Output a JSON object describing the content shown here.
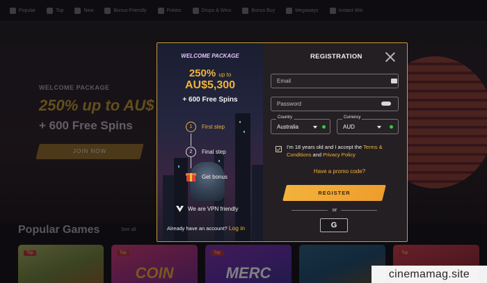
{
  "nav": {
    "items": [
      {
        "icon": "popular-icon",
        "label": "Popular"
      },
      {
        "icon": "top-icon",
        "label": "Top"
      },
      {
        "icon": "new-icon",
        "label": "New"
      },
      {
        "icon": "bonus-friendly-icon",
        "label": "Bonus-Friendly"
      },
      {
        "icon": "pokies-icon",
        "label": "Pokies"
      },
      {
        "icon": "drops-wins-icon",
        "label": "Drops & Wins"
      },
      {
        "icon": "bonus-buy-icon",
        "label": "Bonus Buy"
      },
      {
        "icon": "megaways-icon",
        "label": "Megaways"
      },
      {
        "icon": "instant-win-icon",
        "label": "Instant Win"
      }
    ]
  },
  "hero": {
    "subtitle": "WELCOME PACKAGE",
    "headline": "250% up to AU$",
    "spins": "+ 600 Free Spins",
    "cta": "JOIN NOW"
  },
  "games": {
    "title": "Popular Games",
    "see_all": "See all",
    "badge": "Top",
    "cards": [
      {
        "title": ""
      },
      {
        "title": "COIN"
      },
      {
        "title": "MERC"
      },
      {
        "title": ""
      },
      {
        "title": ""
      }
    ]
  },
  "modal": {
    "left": {
      "package_label": "WELCOME PACKAGE",
      "percent": "250%",
      "up_to": "up to",
      "amount": "AU$5,300",
      "free_spins": "+ 600 Free Spins",
      "steps": [
        {
          "num": "1",
          "label": "First step"
        },
        {
          "num": "2",
          "label": "Final step"
        },
        {
          "num": "",
          "label": "Get bonus"
        }
      ],
      "vpn": "We are VPN friendly",
      "have_account": "Already have an account?",
      "login": "Log in"
    },
    "title": "REGISTRATION",
    "email_placeholder": "Email",
    "password_placeholder": "Password",
    "country_label": "Country",
    "country_value": "Australia",
    "currency_label": "Currency",
    "currency_value": "AUD",
    "terms_prefix": "I'm 18 years old and I accept the ",
    "terms_link": "Terms & Conditions",
    "terms_and": " and ",
    "privacy_link": "Privacy Policy",
    "promo": "Have a promo code?",
    "register": "REGISTER",
    "or": "or",
    "google": "G"
  },
  "watermark": "cinemamag.site",
  "colors": {
    "accent": "#f0b43a",
    "border": "#c99a3a",
    "status_green": "#39c93a",
    "purple_label": "#e2c4ff"
  }
}
